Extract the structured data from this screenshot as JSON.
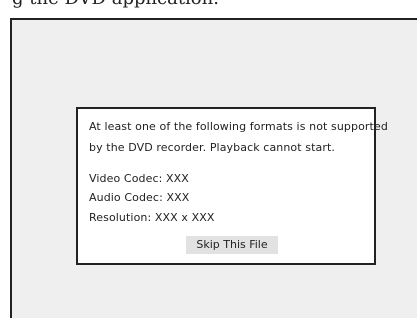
{
  "caption": "g the DVD application.",
  "dialog": {
    "line1": "At least one of the following formats is not supported",
    "line2": "by the DVD recorder. Playback cannot start.",
    "video_codec": "Video Codec: XXX",
    "audio_codec": "Audio Codec: XXX",
    "resolution": "Resolution: XXX x XXX",
    "skip_button": "Skip This File"
  }
}
